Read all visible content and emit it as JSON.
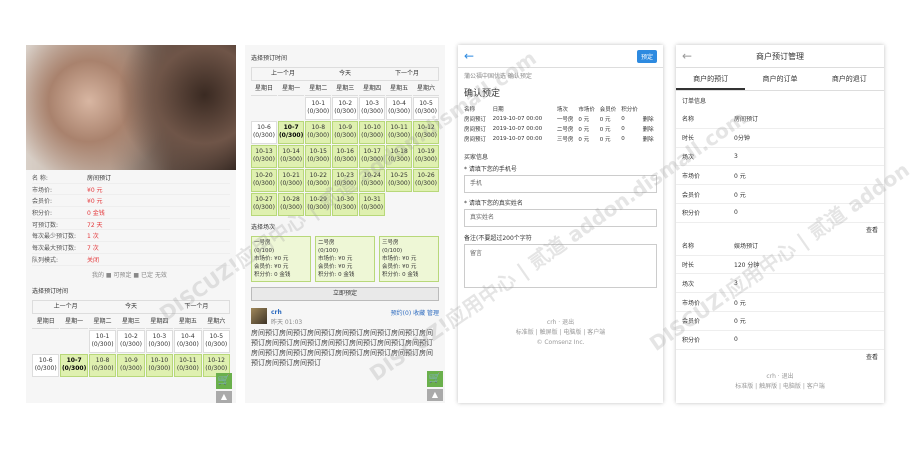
{
  "p1": {
    "info": [
      {
        "k": "名  称:",
        "v": "房间预订",
        "cls": ""
      },
      {
        "k": "市场价:",
        "v": "¥0 元",
        "cls": "red"
      },
      {
        "k": "会员价:",
        "v": "¥0 元",
        "cls": "red"
      },
      {
        "k": "积分价:",
        "v": "0 金钱",
        "cls": "red"
      },
      {
        "k": "可预订数:",
        "v": "72 天",
        "cls": "red"
      },
      {
        "k": "每次最少预订数:",
        "v": "1 次",
        "cls": "red"
      },
      {
        "k": "每次最大预订数:",
        "v": "7 次",
        "cls": "red"
      },
      {
        "k": "队列模式:",
        "v": "关闭",
        "cls": "red"
      }
    ],
    "legend": "我的 ■ 可预定 ■ 已定   无效",
    "section": "选择预订时间",
    "nav": [
      "上一个月",
      "今天",
      "下一个月"
    ],
    "weekdays": [
      "星期日",
      "星期一",
      "星期二",
      "星期三",
      "星期四",
      "星期五",
      "星期六"
    ],
    "days_row1": [
      "10-1\n(0/300)",
      "10-2\n(0/300)",
      "10-3\n(0/300)",
      "10-4\n(0/300)",
      "10-5\n(0/300)"
    ],
    "days_row2": [
      "10-6\n(0/300)",
      "10-7\n(0/300)",
      "10-8\n(0/300)",
      "10-9\n(0/300)",
      "10-10\n(0/300)",
      "10-11\n(0/300)",
      "10-12\n(0/300)"
    ]
  },
  "p2": {
    "section": "选择预订时间",
    "nav": [
      "上一个月",
      "今天",
      "下一个月"
    ],
    "weekdays": [
      "星期日",
      "星期一",
      "星期二",
      "星期三",
      "星期四",
      "星期五",
      "星期六"
    ],
    "weeks": [
      [
        "",
        "",
        "10-1\n(0/300)",
        "10-2\n(0/300)",
        "10-3\n(0/300)",
        "10-4\n(0/300)",
        "10-5\n(0/300)"
      ],
      [
        "10-6\n(0/300)",
        "10-7\n(0/300)",
        "10-8\n(0/300)",
        "10-9\n(0/300)",
        "10-10\n(0/300)",
        "10-11\n(0/300)",
        "10-12\n(0/300)"
      ],
      [
        "10-13\n(0/300)",
        "10-14\n(0/300)",
        "10-15\n(0/300)",
        "10-16\n(0/300)",
        "10-17\n(0/300)",
        "10-18\n(0/300)",
        "10-19\n(0/300)"
      ],
      [
        "10-20\n(0/300)",
        "10-21\n(0/300)",
        "10-22\n(0/300)",
        "10-23\n(0/300)",
        "10-24\n(0/300)",
        "10-25\n(0/300)",
        "10-26\n(0/300)"
      ],
      [
        "10-27\n(0/300)",
        "10-28\n(0/300)",
        "10-29\n(0/300)",
        "10-30\n(0/300)",
        "10-31\n(0/300)",
        "",
        ""
      ]
    ],
    "plan_section": "选择场次",
    "plans": [
      {
        "name": "一号房",
        "count": "(0/100)",
        "lines": [
          "市场价: ¥0 元",
          "会员价: ¥0 元",
          "积分价: 0 金钱"
        ]
      },
      {
        "name": "二号房",
        "count": "(0/100)",
        "lines": [
          "市场价: ¥0 元",
          "会员价: ¥0 元",
          "积分价: 0 金钱"
        ]
      },
      {
        "name": "三号房",
        "count": "(0/100)",
        "lines": [
          "市场价: ¥0 元",
          "会员价: ¥0 元",
          "积分价: 0 金钱"
        ]
      }
    ],
    "submit": "立即预定",
    "comment": {
      "user": "crh",
      "time": "昨天 01:03",
      "actions": "预约(0)  收藏  管理",
      "text": "房间预订房间预订房间预订房间预订房间预订房间预订房间预订房间预订房间预订房间预订房间预订房间预订房间预订房间预订房间预订房间预订房间预订房间预订房间预订房间预订房间预订房间预订"
    }
  },
  "p3": {
    "chip": "预定",
    "breadcrumb": "蒲公福中国优选 确认预定",
    "title": "确认预定",
    "headers": [
      "名称",
      "日期",
      "场次",
      "市场价",
      "会员价",
      "积分价"
    ],
    "rows": [
      [
        "房间预订",
        "2019-10-07 00:00",
        "一号房",
        "0 元",
        "0 元",
        "0",
        "删除"
      ],
      [
        "房间预订",
        "2019-10-07 00:00",
        "二号房",
        "0 元",
        "0 元",
        "0",
        "删除"
      ],
      [
        "房间预订",
        "2019-10-07 00:00",
        "三号房",
        "0 元",
        "0 元",
        "0",
        "删除"
      ]
    ],
    "buyer_label": "买家信息",
    "phone_label": "* 请填下您的手机号",
    "phone_ph": "手机",
    "name_label": "* 请填下您的真实姓名",
    "name_ph": "真实姓名",
    "note_label": "备注(不要超过200个字符",
    "note_ph": "留言",
    "footer": [
      "crh  ·  退出",
      "标准版  |  触屏版  |  电脑版  |  客户端",
      "© Comsenz Inc."
    ]
  },
  "p4": {
    "title": "商户预订管理",
    "tabs": [
      "商户的预订",
      "商户的订单",
      "商户的退订"
    ],
    "section": "订单信息",
    "group1": [
      [
        "名称",
        "房间预订"
      ],
      [
        "时长",
        "0分钟"
      ],
      [
        "场次",
        "3"
      ],
      [
        "市场价",
        "0 元"
      ],
      [
        "会员价",
        "0 元"
      ],
      [
        "积分价",
        "0"
      ]
    ],
    "more1": "查看",
    "group2": [
      [
        "名称",
        "娱场预订"
      ],
      [
        "时长",
        "120 分钟"
      ],
      [
        "场次",
        "3"
      ],
      [
        "市场价",
        "0 元"
      ],
      [
        "会员价",
        "0 元"
      ],
      [
        "积分价",
        "0"
      ]
    ],
    "more2": "查看",
    "footer": [
      "crh  ·  退出",
      "标准版  |  触屏版  |  电脑版  |  客户端"
    ]
  },
  "watermark": "DISCUZ!应用中心 | 贰道 addon.dismall.com"
}
